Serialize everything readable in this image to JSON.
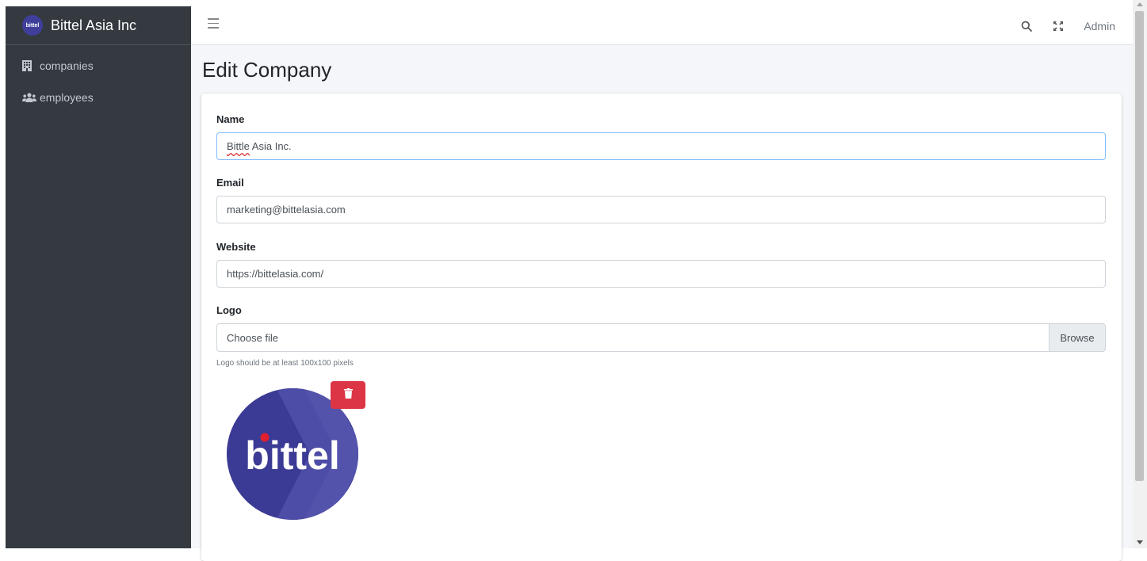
{
  "sidebar": {
    "brand_logo_text": "bittel",
    "brand_name": "Bittel Asia Inc",
    "items": [
      {
        "label": "companies",
        "icon": "building-icon"
      },
      {
        "label": "employees",
        "icon": "users-icon"
      }
    ]
  },
  "topbar": {
    "user_label": "Admin",
    "icons": [
      "menu-icon",
      "search-icon",
      "expand-icon"
    ]
  },
  "page": {
    "title": "Edit Company"
  },
  "form": {
    "name_label": "Name",
    "name_value_misspelled": "Bittle",
    "name_value_rest": " Asia Inc.",
    "email_label": "Email",
    "email_value": "marketing@bittelasia.com",
    "website_label": "Website",
    "website_value": "https://bittelasia.com/",
    "logo_label": "Logo",
    "logo_placeholder": "Choose file",
    "browse_label": "Browse",
    "logo_help": "Logo should be at least 100x100 pixels"
  },
  "logo_preview": {
    "text": "bittel",
    "colors": {
      "background": "#3b3a94",
      "dot": "#e0202e",
      "text": "#ffffff"
    }
  },
  "colors": {
    "sidebar": "#343a40",
    "content_bg": "#f4f6f9",
    "danger": "#dc3545",
    "focus_border": "#80bdff"
  }
}
